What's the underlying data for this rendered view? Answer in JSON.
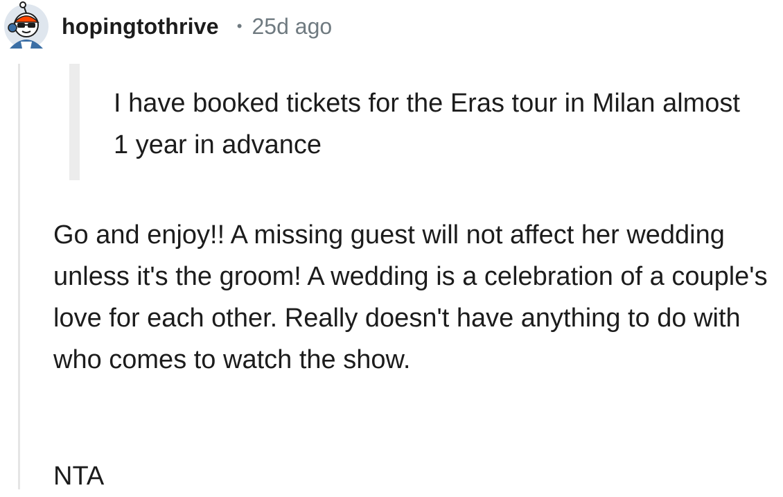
{
  "comment": {
    "author": {
      "username": "hopingtothrive",
      "avatar_icon": "snoo-avatar-icon"
    },
    "separator": "•",
    "timestamp": "25d ago",
    "quote": {
      "text": "I have booked tickets for the Eras tour in Milan almost 1 year in advance"
    },
    "body": "Go and enjoy!! A missing guest will not affect her wedding unless it's the groom! A wedding is a celebration of a couple's love for each other. Really doesn't have anything to do with who comes to watch the show.",
    "verdict": "NTA"
  },
  "colors": {
    "text": "#1c1c1c",
    "meta": "#6f7a80",
    "thread_line": "#e5e5e5",
    "quote_bar": "#ececec",
    "avatar_accent": "#ff4500"
  }
}
